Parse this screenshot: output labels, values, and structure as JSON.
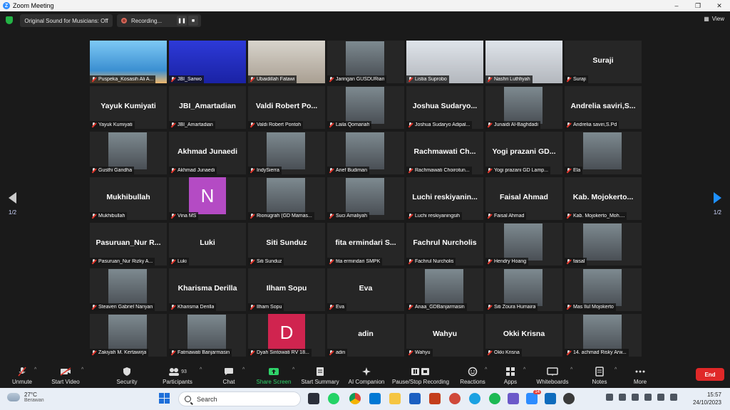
{
  "window": {
    "title": "Zoom Meeting",
    "controls": [
      "–",
      "❐",
      "✕"
    ]
  },
  "topbar": {
    "original_sound": "Original Sound for Musicians: Off",
    "recording": "Recording...",
    "view": "View"
  },
  "tiles": [
    {
      "big": "",
      "label": "Puspeka_Kosasih Ali A...",
      "photo": "poster"
    },
    {
      "big": "",
      "label": "JBI_Sarwo",
      "photo": "blue"
    },
    {
      "big": "",
      "label": "Ubaidillah Fatawi",
      "photo": "light",
      "active": true
    },
    {
      "big": "",
      "label": "Jaringan GUSDURian",
      "photo": "small"
    },
    {
      "big": "",
      "label": "Listia Suprobo",
      "photo": "rose"
    },
    {
      "big": "",
      "label": "Nashri Luthfiyah",
      "photo": "rose"
    },
    {
      "big": "Suraji",
      "label": "Suraji"
    },
    {
      "big": "Yayuk Kumiyati",
      "label": "Yayuk Kumiyati"
    },
    {
      "big": "JBI_Amartadian",
      "label": "JBI_Amartadian"
    },
    {
      "big": "Valdi Robert Po...",
      "label": "Valdi Robert Pontoh"
    },
    {
      "big": "",
      "label": "Laila Qomariah",
      "photo": "small"
    },
    {
      "big": "Joshua Sudaryo...",
      "label": "Joshua Sudaryo Adipal..."
    },
    {
      "big": "",
      "label": "Junaidi Al-Baghdadi",
      "photo": "small"
    },
    {
      "big": "Andrelia saviri,S...",
      "label": "Andrelia saviri,S.Pd"
    },
    {
      "big": "",
      "label": "Gusthi Gandha",
      "photo": "small"
    },
    {
      "big": "Akhmad Junaedi",
      "label": "Akhmad Junaedi"
    },
    {
      "big": "",
      "label": "IndySierra",
      "photo": "small"
    },
    {
      "big": "",
      "label": "Arief Budiman",
      "photo": "small"
    },
    {
      "big": "Rachmawati Ch...",
      "label": "Rachmawati Choirotun..."
    },
    {
      "big": "Yogi prazani GD...",
      "label": "Yogi prazani GD Lamp..."
    },
    {
      "big": "",
      "label": "Ela",
      "photo": "small"
    },
    {
      "big": "Mukhibullah",
      "label": "Mukhibullah"
    },
    {
      "big": "",
      "label": "Vina MS",
      "letter": "N",
      "letter_bg": "#b44bc4"
    },
    {
      "big": "",
      "label": "Rionugrah (GD Mamas...",
      "photo": "small"
    },
    {
      "big": "",
      "label": "Suci Amaliyah",
      "photo": "small"
    },
    {
      "big": "Luchi reskiyanin...",
      "label": "Luchi reskiyaningsih"
    },
    {
      "big": "Faisal Ahmad",
      "label": "Faisal Ahmad"
    },
    {
      "big": "Kab. Mojokerto...",
      "label": "Kab. Mojokerto_Moh...."
    },
    {
      "big": "Pasuruan_Nur R...",
      "label": "Pasuruan_Nur Rizky A..."
    },
    {
      "big": "Luki",
      "label": "Luki"
    },
    {
      "big": "Siti Sunduz",
      "label": "Siti Sunduz"
    },
    {
      "big": "fita ermindari S...",
      "label": "fita ermindari SMPK"
    },
    {
      "big": "Fachrul Nurcholis",
      "label": "Fachrul Nurcholis"
    },
    {
      "big": "",
      "label": "Hendry Hoang",
      "photo": "small"
    },
    {
      "big": "",
      "label": "faisal",
      "photo": "small"
    },
    {
      "big": "",
      "label": "Steaven Gabriel Nanyan",
      "photo": "small"
    },
    {
      "big": "Kharisma Derilla",
      "label": "Kharisma Derilla"
    },
    {
      "big": "Ilham Sopu",
      "label": "Ilham Sopu"
    },
    {
      "big": "Eva",
      "label": "Eva"
    },
    {
      "big": "",
      "label": "Anaa_GDBanjarmasin",
      "photo": "small"
    },
    {
      "big": "",
      "label": "Siti Zoura Humaira",
      "photo": "small"
    },
    {
      "big": "",
      "label": "Mas Ilul Mojokerto",
      "photo": "small"
    },
    {
      "big": "",
      "label": "Zakiyah M. Kertawirja",
      "photo": "small"
    },
    {
      "big": "",
      "label": "Fatmawati Banjarmasin",
      "photo": "small"
    },
    {
      "big": "",
      "label": "Dyah Sintowati RV 18...",
      "letter": "D",
      "letter_bg": "#d0244f"
    },
    {
      "big": "adin",
      "label": "adin"
    },
    {
      "big": "Wahyu",
      "label": "Wahyu"
    },
    {
      "big": "Okki Krisna",
      "label": "Okki Krisna"
    },
    {
      "big": "",
      "label": "14. achmad Risky Arw...",
      "photo": "small"
    }
  ],
  "pager": {
    "left": "1/2",
    "right": "1/2"
  },
  "toolbar": {
    "unmute": "Unmute",
    "start_video": "Start Video",
    "security": "Security",
    "participants": "Participants",
    "participants_count": "93",
    "chat": "Chat",
    "share_screen": "Share Screen",
    "start_summary": "Start Summary",
    "ai_companion": "AI Companion",
    "pause_recording": "Pause/Stop Recording",
    "reactions": "Reactions",
    "apps": "Apps",
    "whiteboards": "Whiteboards",
    "notes": "Notes",
    "more": "More",
    "end": "End"
  },
  "taskbar": {
    "temperature": "27°C",
    "weather": "Berawan",
    "search": "Search",
    "time": "15:57",
    "date": "24/10/2023",
    "notif_badge": "14"
  },
  "colors": {
    "accent": "#2d8cff",
    "end": "#e02828",
    "active_border": "#d7ec58",
    "share_green": "#2fd36a"
  }
}
